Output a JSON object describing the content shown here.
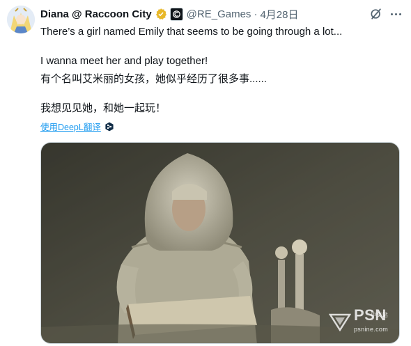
{
  "tweet": {
    "display_name": "Diana @ Raccoon City",
    "handle": "@RE_Games",
    "separator": "·",
    "date": "4月28日",
    "lines": [
      "There’s a girl named Emily that seems to be going through a lot...",
      "I wanna meet her and play together!",
      "有个名叫艾米丽的女孩，她似乎经历了很多事......",
      "我想见见她，和她一起玩！"
    ],
    "translate_label": "使用DeepL翻译",
    "icons": {
      "verified": "verified-badge-icon",
      "affiliate": "affiliate-logo-icon",
      "grok": "grok-icon",
      "more": "more-options-icon",
      "deepl": "deepl-icon"
    },
    "colors": {
      "verified_gold": "#e8b829",
      "link_blue": "#1d9bf0",
      "secondary_text": "#536471"
    }
  },
  "media": {
    "watermark": "PSN",
    "watermark_sub": "psnine.com",
    "watermark_cn": "中文站"
  }
}
